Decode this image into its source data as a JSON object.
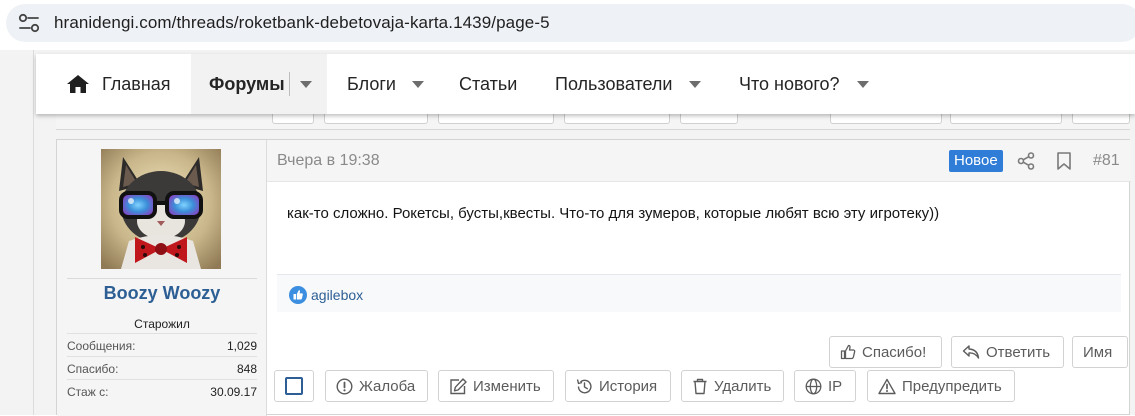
{
  "browser": {
    "url": "hranidengi.com/threads/roketbank-debetovaja-karta.1439/page-5"
  },
  "nav": {
    "items": [
      {
        "label": "Главная"
      },
      {
        "label": "Форумы"
      },
      {
        "label": "Блоги"
      },
      {
        "label": "Статьи"
      },
      {
        "label": "Пользователи"
      },
      {
        "label": "Что нового?"
      }
    ]
  },
  "post": {
    "user": {
      "name": "Boozy Woozy",
      "title": "Старожил",
      "stats": [
        {
          "key": "Сообщения:",
          "value": "1,029"
        },
        {
          "key": "Спасибо:",
          "value": "848"
        },
        {
          "key": "Стаж с:",
          "value": "30.09.17"
        }
      ]
    },
    "date": "Вчера в 19:38",
    "badge": "Новое",
    "number": "#81",
    "text": "как-то сложно. Рокетсы, бусты,квесты. Что-то для зумеров, которые любят всю эту игротеку))",
    "reactions": {
      "user": "agilebox"
    },
    "actions_right": {
      "thanks": "Спасибо!",
      "reply": "Ответить",
      "name": "Имя"
    },
    "actions_bottom": {
      "report": "Жалоба",
      "edit": "Изменить",
      "history": "История",
      "delete": "Удалить",
      "ip": "IP",
      "warn": "Предупредить"
    }
  },
  "colors": {
    "accent": "#2d5f94",
    "badge": "#2f7dd6",
    "nav_active_bg": "#f2f2f2"
  }
}
